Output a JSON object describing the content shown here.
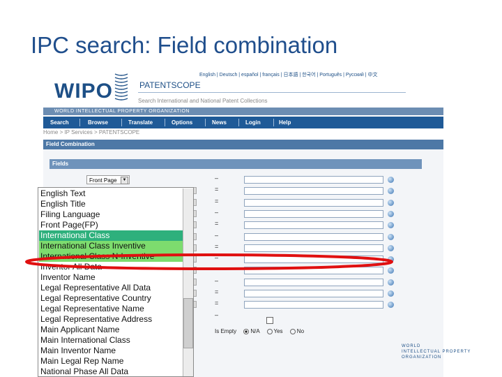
{
  "slide": {
    "title": "IPC search: Field combination"
  },
  "header": {
    "logo_text": "WIPO",
    "brand": "PATENTSCOPE",
    "languages": "English | Deutsch | español | français | 日本語 | 한국어 | Português | Русский | 中文",
    "subtitle": "Search International and National Patent Collections",
    "org_name": "WORLD INTELLECTUAL PROPERTY ORGANIZATION"
  },
  "nav": {
    "items": [
      {
        "label": "Search"
      },
      {
        "label": "Browse"
      },
      {
        "label": "Translate"
      },
      {
        "label": "Options"
      },
      {
        "label": "News"
      },
      {
        "label": "Login"
      },
      {
        "label": "Help"
      }
    ]
  },
  "breadcrumb": "Home > IP Services > PATENTSCOPE",
  "form": {
    "section_title": "Field Combination",
    "fields_title": "Fields",
    "top_select_value": "Front Page",
    "operators": [
      "–",
      "=",
      "=",
      "–",
      "=",
      "–",
      "=",
      "–",
      "–",
      "–",
      "=",
      "=",
      "–"
    ],
    "is_empty": {
      "label": "Is Empty",
      "options": [
        "N/A",
        "Yes",
        "No"
      ],
      "selected": "N/A"
    }
  },
  "dropdown": {
    "options": [
      "English Text",
      "English Title",
      "Filing Language",
      "Front Page(FP)",
      "International Class",
      "International Class Inventive",
      "International Class N-Inventive",
      "Inventor All Data",
      "Inventor Name",
      "Legal Representative All Data",
      "Legal Representative Country",
      "Legal Representative Name",
      "Legal Representative Address",
      "Main Applicant Name",
      "Main International Class",
      "Main Inventor Name",
      "Main Legal Rep Name",
      "National Phase All Data"
    ],
    "selected": "International Class",
    "highlighted": [
      "International Class",
      "International Class Inventive",
      "International Class N-Inventive"
    ]
  },
  "footer_logo": {
    "line1": "WORLD",
    "line2": "INTELLECTUAL PROPERTY",
    "line3": "ORGANIZATION"
  },
  "colors": {
    "title": "#1f4e8c",
    "nav": "#1f5a97",
    "highlight_green": "#7ddc6e",
    "selected": "#2eb07c",
    "annotation_red": "#e01010"
  }
}
